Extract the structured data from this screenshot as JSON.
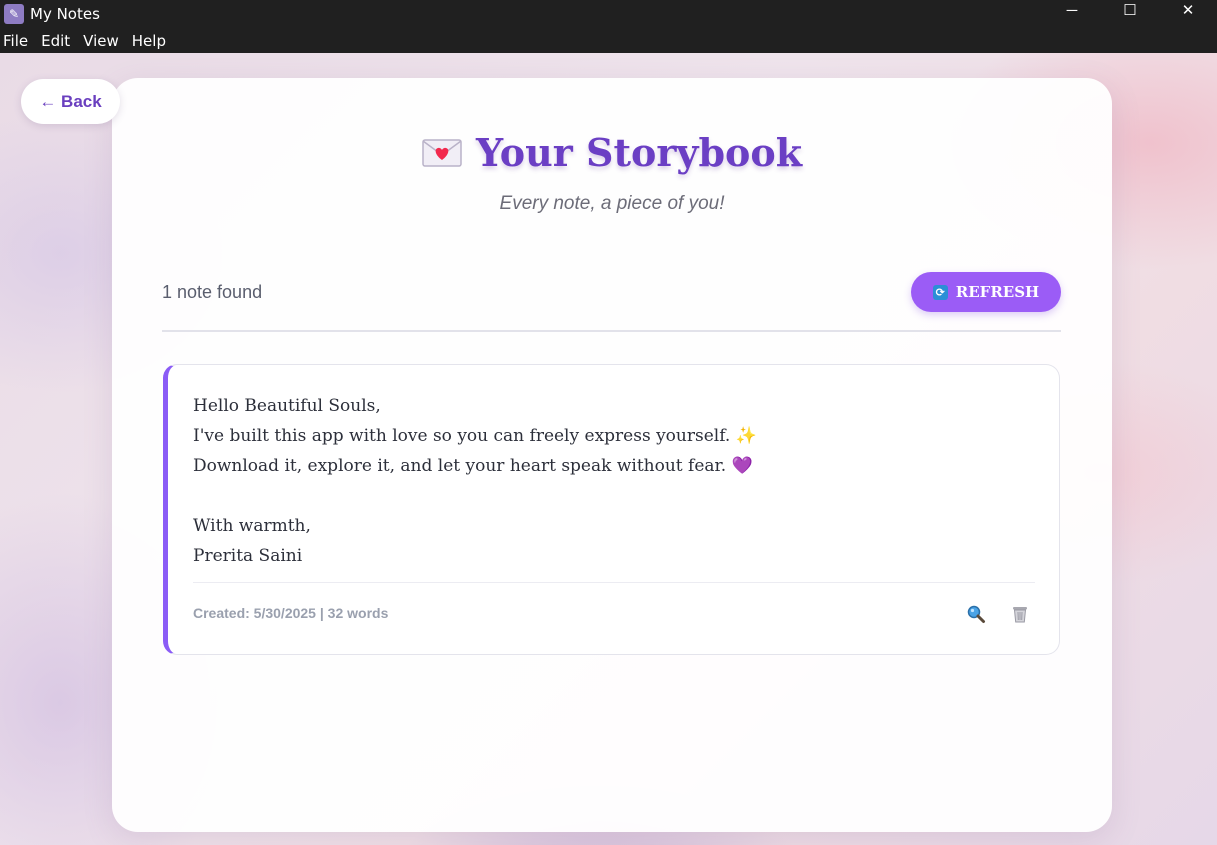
{
  "window": {
    "title": "My Notes",
    "app_icon": "notes-app-icon",
    "controls": {
      "minimize": "─",
      "maximize": "☐",
      "close": "✕"
    }
  },
  "menu": [
    "File",
    "Edit",
    "View",
    "Help"
  ],
  "back_button": {
    "label": "← Back"
  },
  "header": {
    "title": "Your Storybook",
    "title_icon": "love-letter-icon",
    "subtitle": "Every note, a piece of you!"
  },
  "toolbar": {
    "count_text": "1 note found",
    "refresh_label": "REFRESH",
    "refresh_icon": "refresh-icon"
  },
  "notes": [
    {
      "lines": [
        "Hello Beautiful Souls,",
        "I've built this app with love so you can freely express yourself. ✨",
        "Download it, explore it, and let your heart speak without fear. 💜",
        "",
        "With warmth,",
        "Prerita Saini"
      ],
      "meta": "Created: 5/30/2025 | 32 words",
      "actions": [
        "view-icon",
        "delete-icon"
      ]
    }
  ],
  "colors": {
    "accent": "#9b5cf6",
    "title": "#6b3fc4",
    "note_border": "#8b5cf6"
  }
}
